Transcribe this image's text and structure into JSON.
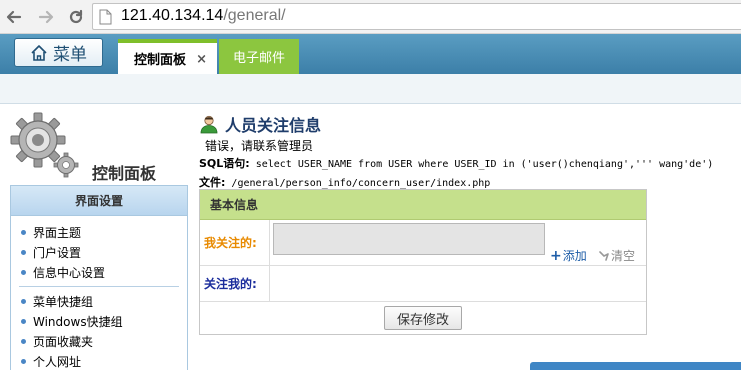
{
  "browser": {
    "url_host": "121.40.134.14",
    "url_path": "/general/"
  },
  "topnav": {
    "menu_label": "菜单",
    "tabs": [
      {
        "label": "控制面板",
        "active": true,
        "close": "×"
      },
      {
        "label": "电子邮件",
        "active": false
      }
    ]
  },
  "sidebar": {
    "panel_title": "控制面板",
    "section_title": "界面设置",
    "group1": [
      {
        "label": "界面主题"
      },
      {
        "label": "门户设置"
      },
      {
        "label": "信息中心设置"
      }
    ],
    "group2": [
      {
        "label": "菜单快捷组"
      },
      {
        "label": "Windows快捷组"
      },
      {
        "label": "页面收藏夹"
      },
      {
        "label": "个人网址"
      }
    ]
  },
  "content": {
    "title": "人员关注信息",
    "error": "错误，请联系管理员",
    "sql_label": "SQL语句:",
    "sql_value": " select USER_NAME from USER where USER_ID in ('user()chenqiang',''' wang'de')",
    "file_label": "文件:",
    "file_value": " /general/person_info/concern_user/index.php",
    "table": {
      "heading": "基本信息",
      "my_concern_label": "我关注的:",
      "add_label": "添加",
      "clear_label": "清空",
      "concern_me_label": "关注我的:",
      "save_label": "保存修改"
    }
  },
  "colors": {
    "nav_blue": "#4a8db5",
    "tab_green": "#8cc63f",
    "table_head_green": "#c5e08c",
    "label_orange": "#e88a00",
    "label_blue": "#1a2c9c"
  }
}
